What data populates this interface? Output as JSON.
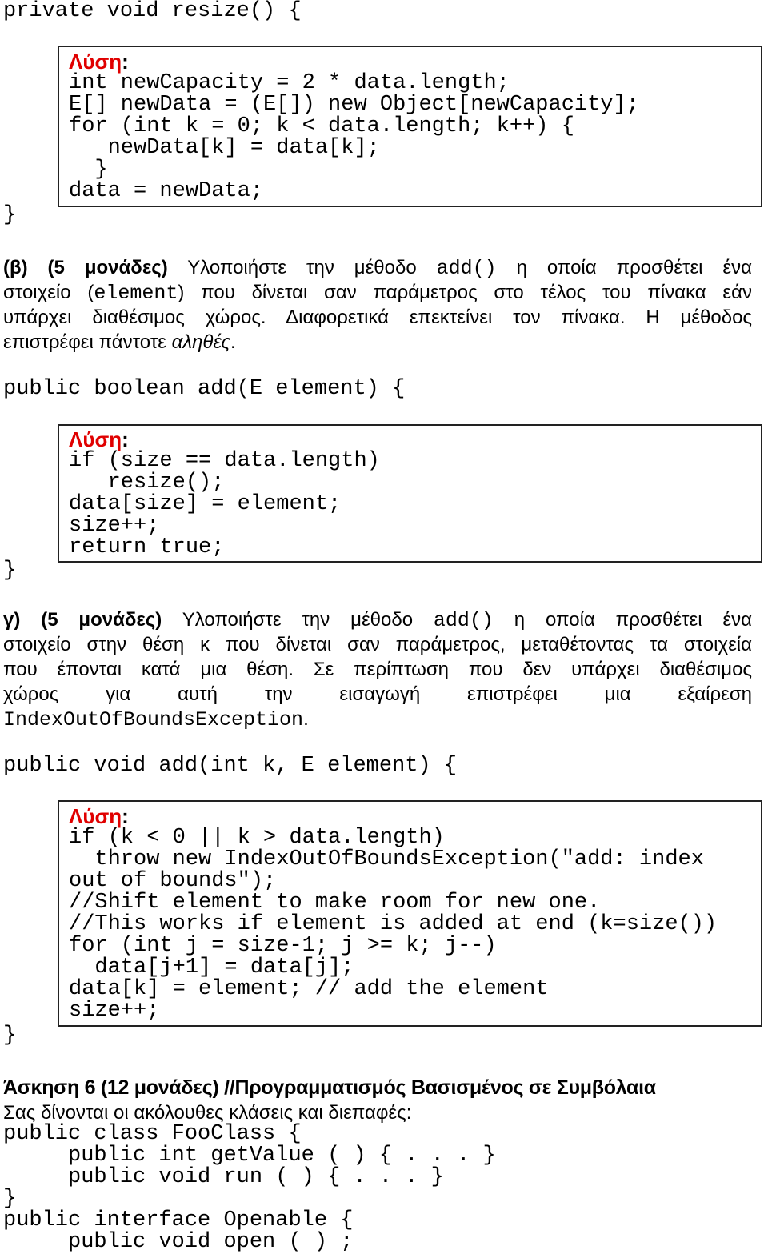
{
  "solution_label": "Λύση",
  "solution_colon": ":",
  "colors": {
    "solution_label": "#e00000"
  },
  "resize": {
    "signature": [
      "private void resize() {"
    ],
    "solution": [
      "int newCapacity = 2 * data.length;",
      "E[] newData = (E[]) new Object[newCapacity];",
      "for (int k = 0; k < data.length; k++) {",
      "   newData[k] = data[k];",
      "  }",
      "data = newData;"
    ],
    "close": [
      "}"
    ]
  },
  "part_b": {
    "lines": [
      [
        {
          "t": "(β) (5 μονάδες)",
          "s": "b"
        },
        {
          "t": " Υλοποιήστε την μέθοδο "
        },
        {
          "t": "add()",
          "s": "m"
        },
        {
          "t": " η οποία προσθέτει ένα"
        }
      ],
      [
        {
          "t": "στοιχείο ("
        },
        {
          "t": "element",
          "s": "m"
        },
        {
          "t": ") που δίνεται σαν παράμετρος στο τέλος του πίνακα εάν"
        }
      ],
      [
        {
          "t": "υπάρχει διαθέσιμος χώρος.  Διαφορετικά επεκτείνει τον πίνακα. Η μέθοδος"
        }
      ],
      [
        {
          "t": "επιστρέφει πάντοτε "
        },
        {
          "t": "αληθές",
          "s": "i"
        },
        {
          "t": "."
        }
      ]
    ],
    "signature": [
      "public boolean add(E element) {"
    ],
    "solution": [
      "if (size == data.length)",
      "   resize();",
      "data[size] = element;",
      "size++;",
      "return true;"
    ],
    "close": [
      "}"
    ]
  },
  "part_c": {
    "lines": [
      [
        {
          "t": "γ) (5 μονάδες)",
          "s": "b"
        },
        {
          "t": " Υλοποιήστε την μέθοδο "
        },
        {
          "t": "add()",
          "s": "m"
        },
        {
          "t": " η οποία προσθέτει ένα"
        }
      ],
      [
        {
          "t": "στοιχείο στην θέση κ που δίνεται σαν παράμετρος, μεταθέτοντας τα στοιχεία"
        }
      ],
      [
        {
          "t": "που έπονται κατά μια θέση. Σε περίπτωση που δεν υπάρχει διαθέσιμος"
        }
      ],
      [
        {
          "t": "χώρος για αυτή την εισαγωγή επιστρέφει μια εξαίρεση"
        }
      ],
      [
        {
          "t": "IndexOutOfBoundsException",
          "s": "m"
        },
        {
          "t": "."
        }
      ]
    ],
    "signature": [
      "public void add(int k, E element) {"
    ],
    "solution": [
      "if (k < 0 || k > data.length)",
      "  throw new IndexOutOfBoundsException(\"add: index",
      "out of bounds\");",
      "//Shift element to make room for new one.",
      "//This works if element is added at end (k=size())",
      "for (int j = size-1; j >= k; j--)",
      "  data[j+1] = data[j];",
      "data[k] = element; // add the element",
      "size++;"
    ],
    "close": [
      "}"
    ]
  },
  "exercise6": {
    "heading": "Άσκηση 6 (12 μονάδες) //Προγραμματισμός Βασισμένος σε Συμβόλαια",
    "intro": "Σας δίνονται οι ακόλουθες κλάσεις και διεπαφές:",
    "code": [
      "public class FooClass {",
      "     public int getValue ( ) { . . . }",
      "     public void run ( ) { . . . }",
      "}",
      "public interface Openable {",
      "     public void open ( ) ;"
    ]
  }
}
